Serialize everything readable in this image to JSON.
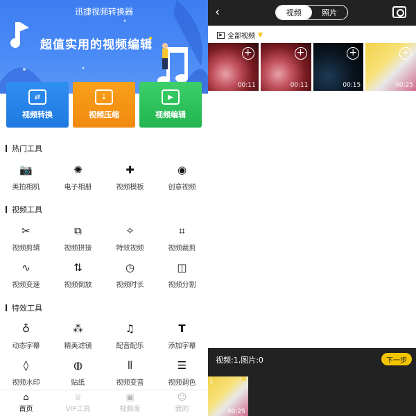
{
  "left": {
    "app_title": "迅捷视频转换器",
    "slogan": "超值实用的视频编辑",
    "feature_cards": [
      {
        "label": "视频转换",
        "icon": "convert-icon",
        "color": "#2f8ff0"
      },
      {
        "label": "视频压缩",
        "icon": "compress-icon",
        "color": "#f9a01a"
      },
      {
        "label": "视频编辑",
        "icon": "edit-video-icon",
        "color": "#3ccf6a"
      }
    ],
    "sections": [
      {
        "title": "热门工具",
        "tools": [
          {
            "label": "美拍相机",
            "icon": "heart-camera-icon"
          },
          {
            "label": "电子相册",
            "icon": "film-reel-icon"
          },
          {
            "label": "视频模板",
            "icon": "puzzle-icon"
          },
          {
            "label": "创意视频",
            "icon": "shutter-icon"
          }
        ]
      },
      {
        "title": "视频工具",
        "tools": [
          {
            "label": "视频剪辑",
            "icon": "scissors-icon"
          },
          {
            "label": "视频拼接",
            "icon": "overlap-squares-icon"
          },
          {
            "label": "特效视频",
            "icon": "magic-wand-icon"
          },
          {
            "label": "视频裁剪",
            "icon": "crop-icon"
          },
          {
            "label": "视频变速",
            "icon": "waveform-icon"
          },
          {
            "label": "视频倒放",
            "icon": "reverse-icon"
          },
          {
            "label": "视频时长",
            "icon": "clock-icon"
          },
          {
            "label": "视频分割",
            "icon": "split-icon"
          }
        ]
      },
      {
        "title": "特效工具",
        "tools": [
          {
            "label": "动态字幕",
            "icon": "balloon-icon"
          },
          {
            "label": "精美滤镜",
            "icon": "filter-circles-icon"
          },
          {
            "label": "配音配乐",
            "icon": "music-note-icon"
          },
          {
            "label": "添加字幕",
            "icon": "text-t-icon"
          },
          {
            "label": "视频水印",
            "icon": "droplet-icon"
          },
          {
            "label": "贴纸",
            "icon": "sticker-icon"
          },
          {
            "label": "视频变音",
            "icon": "voice-wave-icon"
          },
          {
            "label": "视频调色",
            "icon": "sliders-icon"
          }
        ]
      }
    ],
    "bottom_nav": [
      {
        "label": "首页",
        "icon": "home-icon",
        "active": true
      },
      {
        "label": "VIP工具",
        "icon": "crown-icon",
        "active": false
      },
      {
        "label": "视频库",
        "icon": "video-library-icon",
        "active": false
      },
      {
        "label": "我的",
        "icon": "user-icon",
        "active": false
      }
    ]
  },
  "right": {
    "back_icon": "back-arrow-icon",
    "tabs": [
      {
        "label": "视频",
        "selected": true
      },
      {
        "label": "照片",
        "selected": false
      }
    ],
    "camera_icon": "camera-icon",
    "album_label": "全部视频",
    "thumbnails": [
      {
        "duration": "00:11",
        "style": "red"
      },
      {
        "duration": "00:11",
        "style": "red"
      },
      {
        "duration": "00:15",
        "style": "dark"
      },
      {
        "duration": "00:25",
        "style": "pika"
      }
    ],
    "selection_count": "视频:1,图片:0",
    "next_label": "下一步",
    "selected_item": {
      "index": "1",
      "duration": "00:25"
    },
    "accent_color": "#f5c400"
  }
}
